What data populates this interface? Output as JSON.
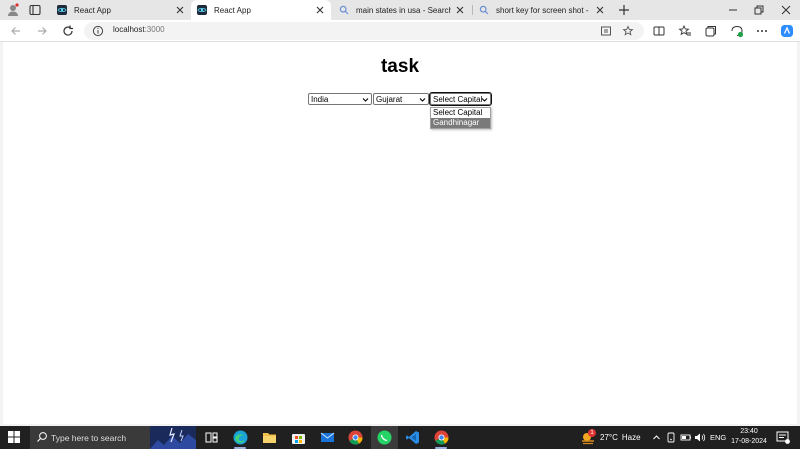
{
  "browser": {
    "tabs": [
      {
        "title": "React App",
        "active": false
      },
      {
        "title": "React App",
        "active": true
      },
      {
        "title": "main states in usa - Search",
        "active": false
      },
      {
        "title": "short key for screen shot - Search",
        "active": false
      }
    ],
    "url": {
      "host": "localhost",
      "port": ":3000"
    }
  },
  "page": {
    "heading": "task",
    "country_select": {
      "value": "India"
    },
    "state_select": {
      "value": "Gujarat"
    },
    "capital_select": {
      "value": "Select Capital",
      "options": [
        "Select Capital",
        "Gandhinagar"
      ],
      "highlighted": "Gandhinagar"
    }
  },
  "taskbar": {
    "search_placeholder": "Type here to search",
    "apps": [
      "task-view-icon",
      "edge-icon",
      "file-explorer-icon",
      "store-icon",
      "mail-icon",
      "chrome-icon",
      "whatsapp-icon",
      "vscode-icon",
      "chrome-dev-icon"
    ],
    "weather": {
      "temp": "27°C",
      "condition": "Haze",
      "badge": "1"
    },
    "language": "ENG",
    "time": "23:40",
    "date": "17-08-2024"
  },
  "colors": {
    "tabstrip": "#e6e6e6",
    "active_tab": "#ffffff",
    "taskbar": "#202020",
    "option_highlight": "#7a7a7a",
    "copilot": "#2d8cff"
  }
}
